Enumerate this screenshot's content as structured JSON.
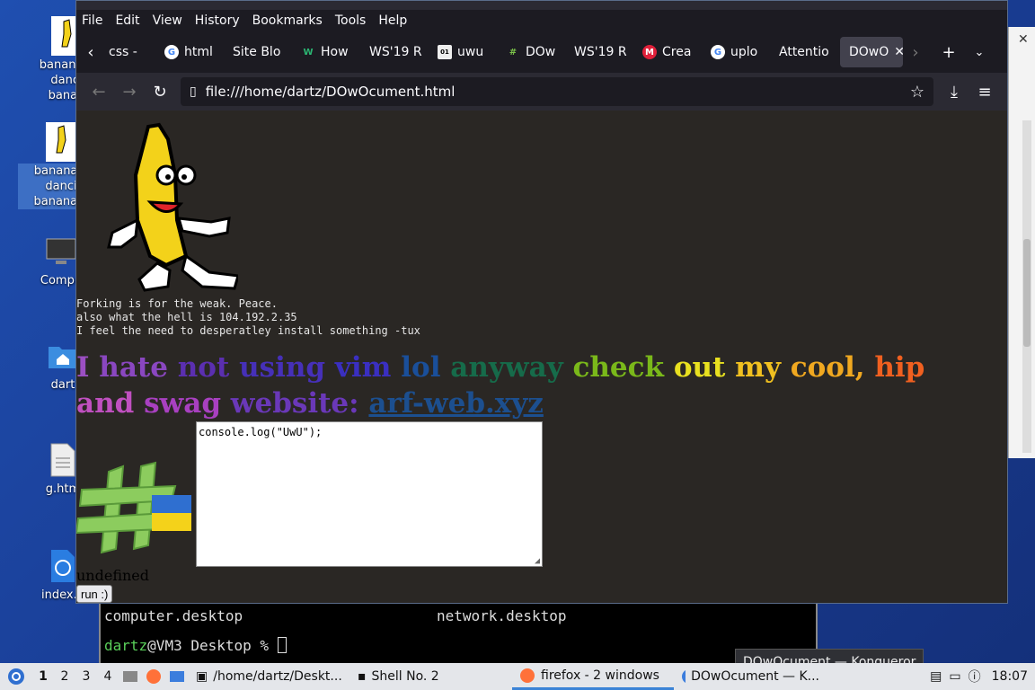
{
  "desktop": {
    "icons": [
      {
        "label": "banana-dancing-banana...",
        "lines": [
          "banana-c",
          "danci",
          "banan"
        ]
      },
      {
        "label": "banana-dancing-banana.gif",
        "lines": [
          "banana-c",
          "danci",
          "banana.g"
        ]
      },
      {
        "label": "Computer",
        "lines": [
          "Compu"
        ]
      },
      {
        "label": "dartz",
        "lines": [
          "dart"
        ]
      },
      {
        "label": "g.html",
        "lines": [
          "g.htm"
        ]
      },
      {
        "label": "index.html",
        "lines": [
          "index.h"
        ]
      }
    ]
  },
  "terminal": {
    "files": [
      "computer.desktop",
      "network.desktop"
    ],
    "prompt_user": "dartz",
    "prompt_rest": "@VM3 Desktop % "
  },
  "browser": {
    "menu": [
      "File",
      "Edit",
      "View",
      "History",
      "Bookmarks",
      "Tools",
      "Help"
    ],
    "tabs": [
      {
        "label": "css -",
        "icon": "css-icon"
      },
      {
        "label": "html",
        "icon": "google-icon"
      },
      {
        "label": "Site Blo",
        "icon": ""
      },
      {
        "label": "How",
        "icon": "w-icon"
      },
      {
        "label": "WS'19 R",
        "icon": ""
      },
      {
        "label": "uwu",
        "icon": "binary-icon"
      },
      {
        "label": "DOw",
        "icon": "hash-icon"
      },
      {
        "label": "WS'19 R",
        "icon": ""
      },
      {
        "label": "Crea",
        "icon": "m-icon"
      },
      {
        "label": "uplo",
        "icon": "google-icon"
      },
      {
        "label": "Attentio",
        "icon": ""
      },
      {
        "label": "DOwO",
        "icon": ""
      }
    ],
    "url": "file:///home/dartz/DOwOcument.html",
    "page": {
      "line1": "Forking is for the weak. Peace.",
      "line2": "also what the hell is 104.192.2.35",
      "line3": "I feel the need to desperatley install something -tux",
      "rainbow_words": [
        {
          "t": "I ",
          "c": "#9b4fc2"
        },
        {
          "t": "hate ",
          "c": "#8a47c0"
        },
        {
          "t": "not ",
          "c": "#5b2fb0"
        },
        {
          "t": "using ",
          "c": "#4630b8"
        },
        {
          "t": "vim ",
          "c": "#3a2fc0"
        },
        {
          "t": "lol ",
          "c": "#1a4f9a"
        },
        {
          "t": "anyway ",
          "c": "#166b4a"
        },
        {
          "t": "check ",
          "c": "#7ab81a"
        },
        {
          "t": "out ",
          "c": "#e8e020"
        },
        {
          "t": "my ",
          "c": "#f0c020"
        },
        {
          "t": "cool, ",
          "c": "#f0a820"
        },
        {
          "t": "hip ",
          "c": "#f06020"
        },
        {
          "t": "and ",
          "c": "#c050c0"
        },
        {
          "t": "swag ",
          "c": "#a840c0"
        },
        {
          "t": "website: ",
          "c": "#6a38b8"
        }
      ],
      "link": "arf-web.xyz",
      "code": "console.log(\"UwU\");",
      "output": "undefined",
      "run_label": "run :)"
    }
  },
  "taskbar": {
    "workspaces": [
      "1",
      "2",
      "3",
      "4"
    ],
    "items": [
      "/home/dartz/Deskt...",
      "Shell No. 2",
      "firefox - 2 windows",
      "DOwOcument — K..."
    ],
    "clock": "18:07"
  },
  "tooltip": "DOwOcument — Konqueror"
}
